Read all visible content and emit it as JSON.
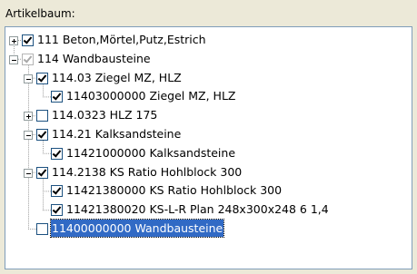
{
  "panel": {
    "label": "Artikelbaum:"
  },
  "tree": {
    "nodes": [
      {
        "text": "111 Beton,Mörtel,Putz,Estrich",
        "level": 0,
        "expander": "collapsed",
        "checked": true,
        "grey": false,
        "selected": false
      },
      {
        "text": "114 Wandbausteine",
        "level": 0,
        "expander": "expanded",
        "checked": true,
        "grey": true,
        "selected": false
      },
      {
        "text": "114.03 Ziegel MZ, HLZ",
        "level": 1,
        "expander": "expanded",
        "checked": true,
        "grey": false,
        "selected": false
      },
      {
        "text": "11403000000 Ziegel MZ, HLZ",
        "level": 2,
        "expander": "none",
        "checked": true,
        "grey": false,
        "selected": false
      },
      {
        "text": "114.0323 HLZ 175",
        "level": 1,
        "expander": "collapsed",
        "checked": false,
        "grey": false,
        "selected": false
      },
      {
        "text": "114.21 Kalksandsteine",
        "level": 1,
        "expander": "expanded",
        "checked": true,
        "grey": false,
        "selected": false
      },
      {
        "text": "11421000000 Kalksandsteine",
        "level": 2,
        "expander": "none",
        "checked": true,
        "grey": false,
        "selected": false
      },
      {
        "text": "114.2138 KS Ratio Hohlblock 300",
        "level": 1,
        "expander": "expanded",
        "checked": true,
        "grey": false,
        "selected": false
      },
      {
        "text": "11421380000 KS Ratio Hohlblock 300",
        "level": 2,
        "expander": "none",
        "checked": true,
        "grey": false,
        "selected": false
      },
      {
        "text": "11421380020 KS-L-R Plan 248x300x248  6  1,4",
        "level": 2,
        "expander": "none",
        "checked": true,
        "grey": false,
        "selected": false
      },
      {
        "text": "11400000000 Wandbausteine",
        "level": 1,
        "expander": "none",
        "checked": false,
        "grey": false,
        "selected": true
      }
    ]
  }
}
